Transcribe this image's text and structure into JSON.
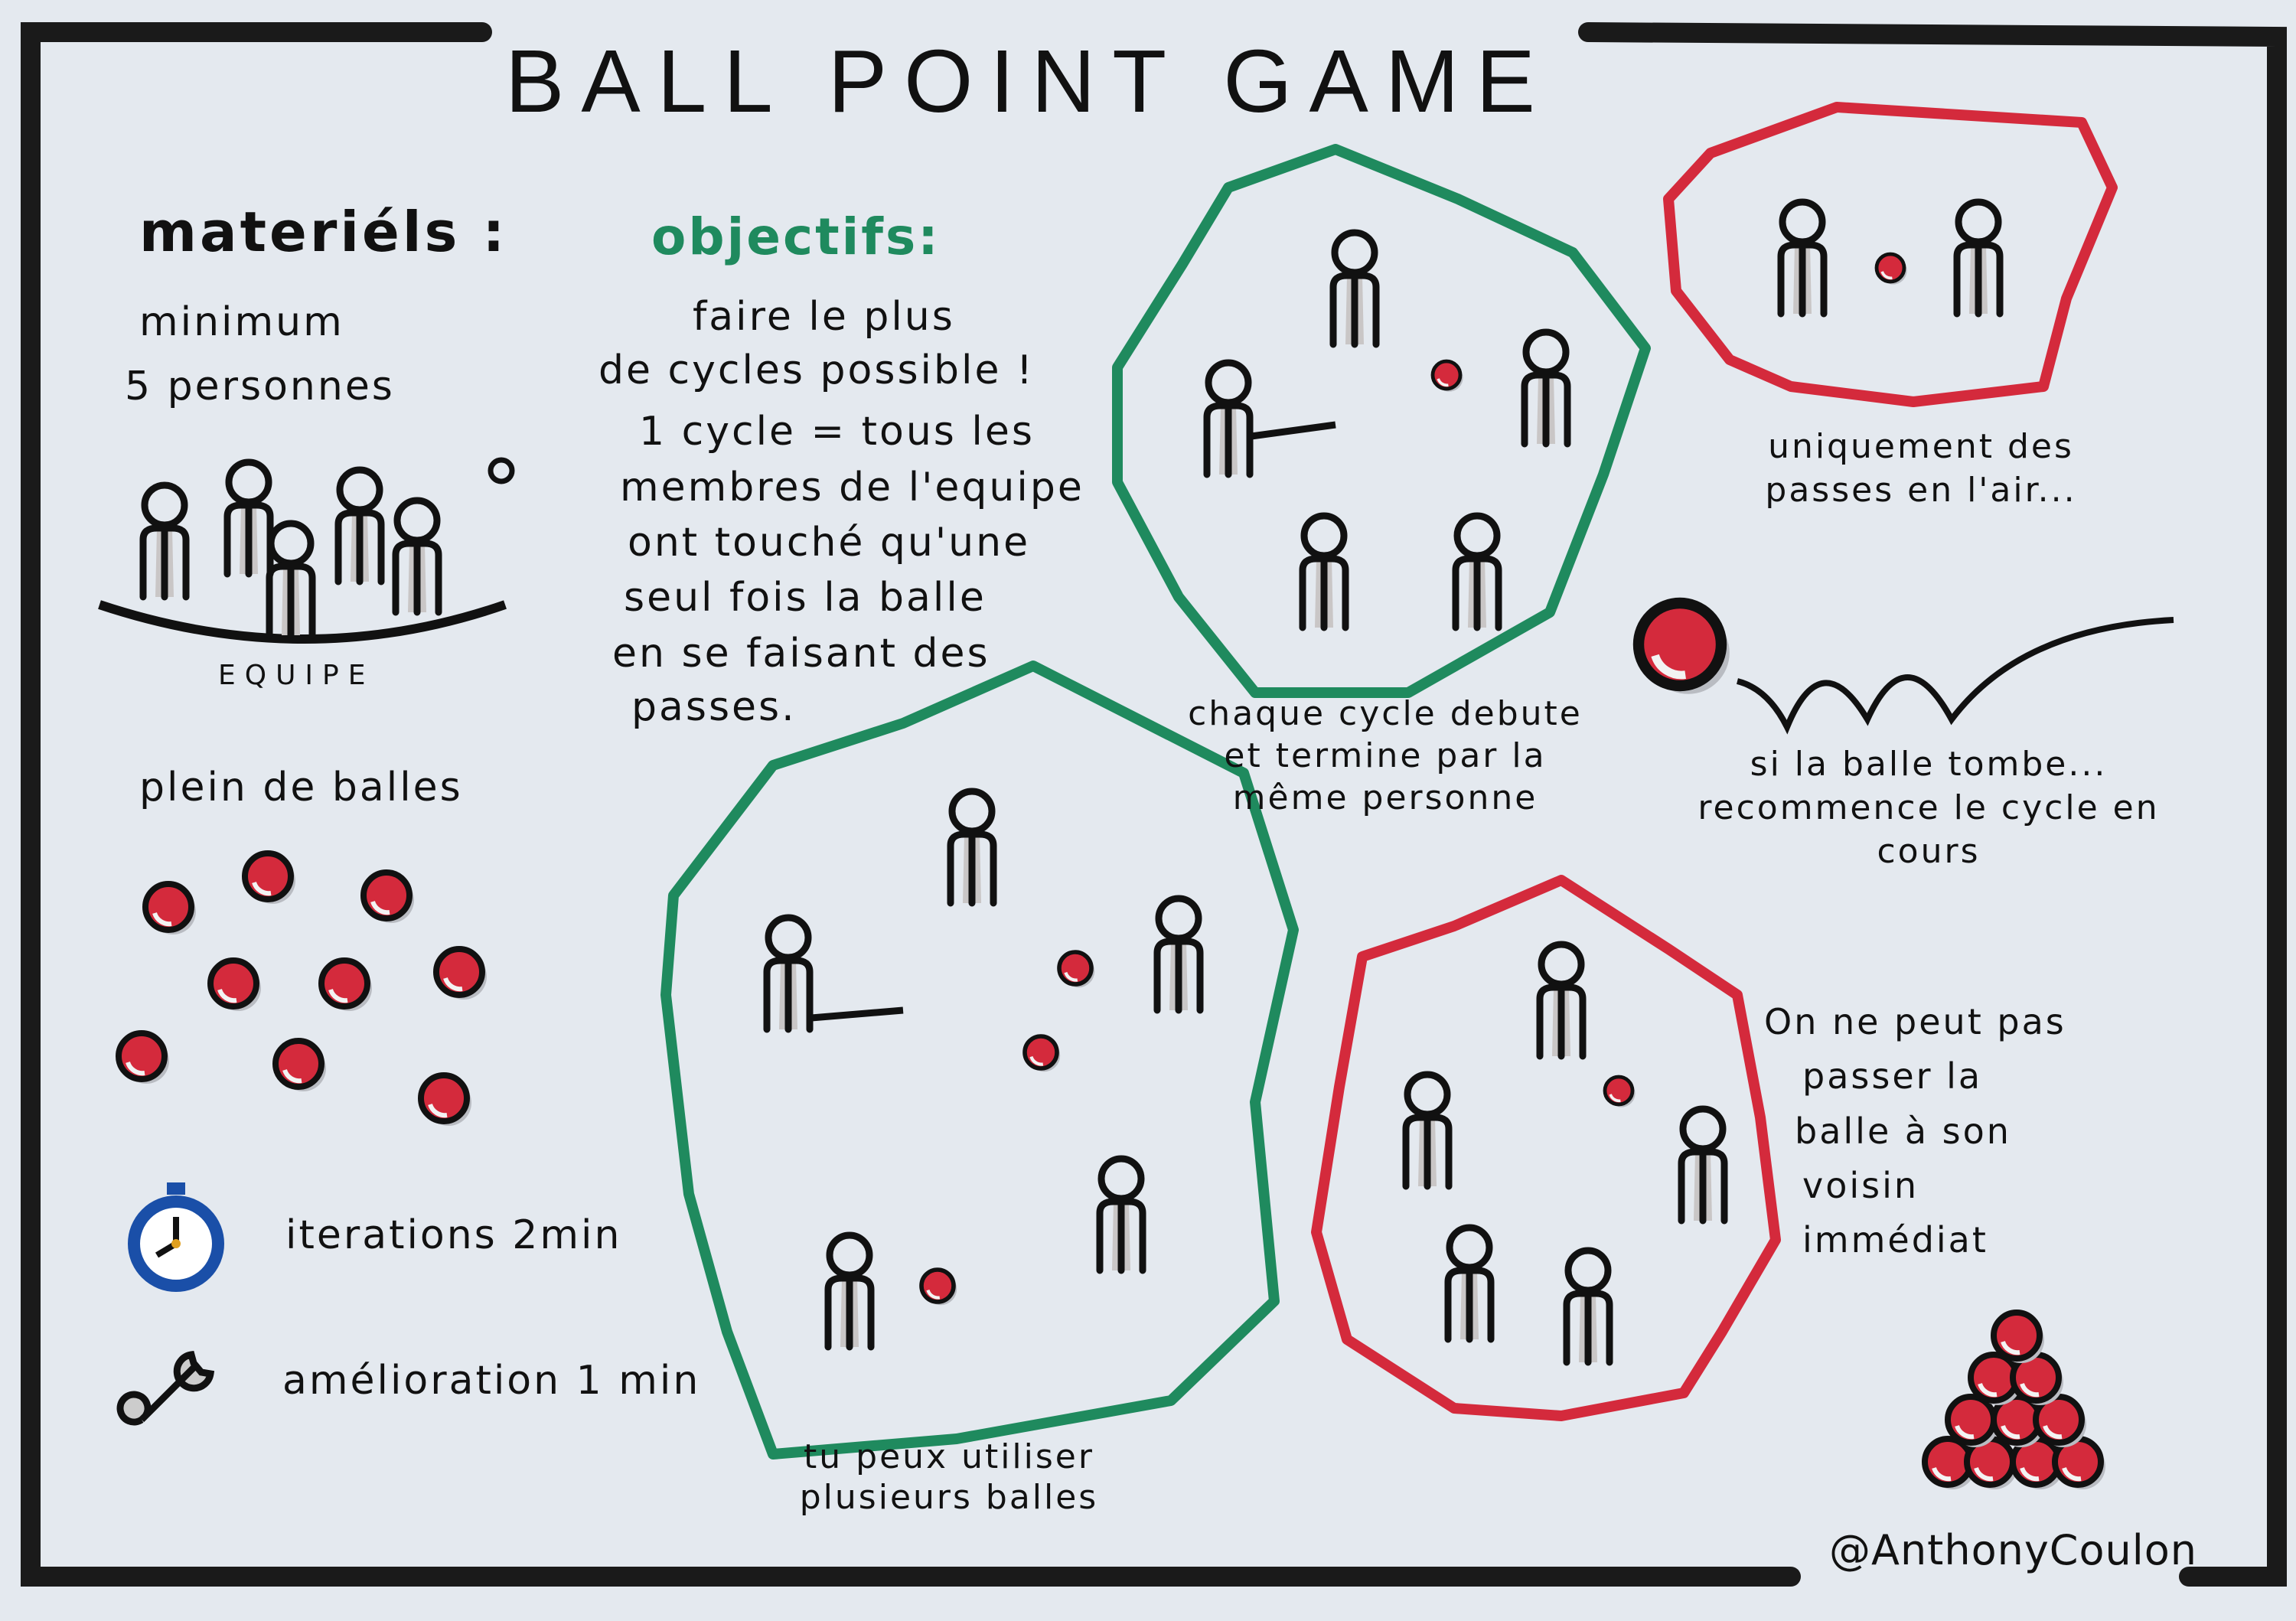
{
  "title": "BALL POINT GAME",
  "materials": {
    "heading": "materiéls :",
    "min_people": [
      "minimum",
      "5 personnes"
    ],
    "team_label": "EQUIPE",
    "balls_label": "plein de balles",
    "iterations": "iterations 2min",
    "improvement": "amélioration 1 min"
  },
  "objectives": {
    "heading": "objectifs:",
    "lines": [
      "faire le plus",
      "de cycles possible !",
      "1 cycle = tous les",
      "membres de l'equipe",
      "ont touché qu'une",
      "seul fois la balle",
      "en se faisant des",
      "passes."
    ]
  },
  "rules": {
    "cycle_caption": [
      "chaque cycle debute",
      "et termine par la",
      "même personne"
    ],
    "air_caption": [
      "uniquement des",
      "passes en l'air..."
    ],
    "drop_caption": [
      "si la balle tombe...",
      "recommence le cycle en",
      "cours"
    ],
    "multi_caption": [
      "tu peux utiliser",
      "plusieurs balles"
    ],
    "neighbor_caption": [
      "On ne peut pas",
      "passer la",
      "balle à son",
      "voisin",
      "immédiat"
    ]
  },
  "author": "@AnthonyCoulon",
  "colors": {
    "green": "#1f8a5e",
    "red": "#d42a3c",
    "ink": "#111111",
    "paper": "#e4e9ef",
    "shadow": "#b9bcc2"
  }
}
